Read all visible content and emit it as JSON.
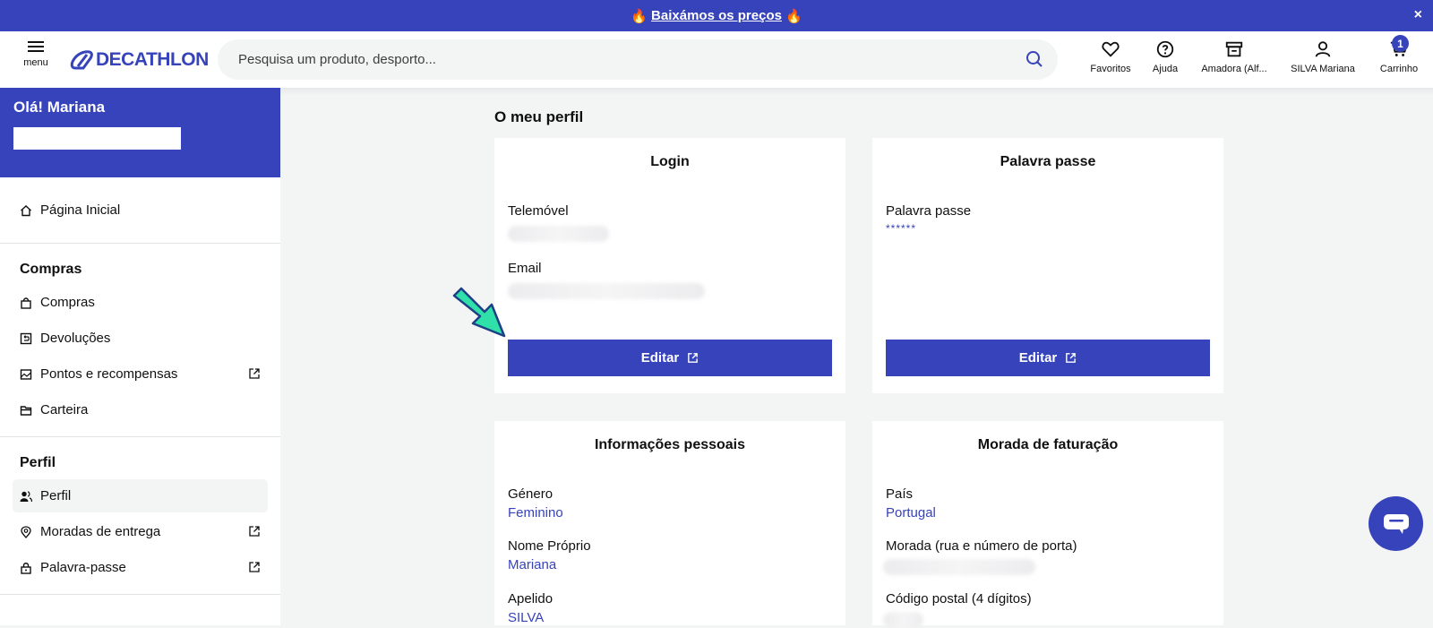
{
  "banner": {
    "text": "Baixámos os preços",
    "flame_left": "🔥",
    "flame_right": "🔥",
    "close": "×"
  },
  "header": {
    "menu_label": "menu",
    "logo": "DECATHLON",
    "search_placeholder": "Pesquisa um produto, desporto...",
    "icons": {
      "favorites": "Favoritos",
      "help": "Ajuda",
      "store": "Amadora (Alf...",
      "account": "SILVA Mariana",
      "cart": "Carrinho"
    },
    "cart_count": "1"
  },
  "sidebar": {
    "greeting": "Olá! Mariana",
    "home": "Página Inicial",
    "compras_title": "Compras",
    "compras_items": [
      "Compras",
      "Devoluções",
      "Pontos e recompensas",
      "Carteira"
    ],
    "perfil_title": "Perfil",
    "perfil_items": [
      "Perfil",
      "Moradas de entrega",
      "Palavra-passe"
    ]
  },
  "main": {
    "title": "O meu perfil",
    "login": {
      "title": "Login",
      "phone_label": "Telemóvel",
      "email_label": "Email",
      "edit": "Editar"
    },
    "password": {
      "title": "Palavra passe",
      "label": "Palavra passe",
      "value": "******",
      "edit": "Editar"
    },
    "personal": {
      "title": "Informações pessoais",
      "gender_label": "Género",
      "gender_value": "Feminino",
      "firstname_label": "Nome Próprio",
      "firstname_value": "Mariana",
      "lastname_label": "Apelido",
      "lastname_value": "SILVA"
    },
    "billing": {
      "title": "Morada de faturação",
      "country_label": "País",
      "country_value": "Portugal",
      "address_label": "Morada (rua e número de porta)",
      "postal_label": "Código postal (4 dígitos)"
    }
  },
  "colors": {
    "brand": "#3643ba",
    "arrow": "#2fe0a8"
  }
}
